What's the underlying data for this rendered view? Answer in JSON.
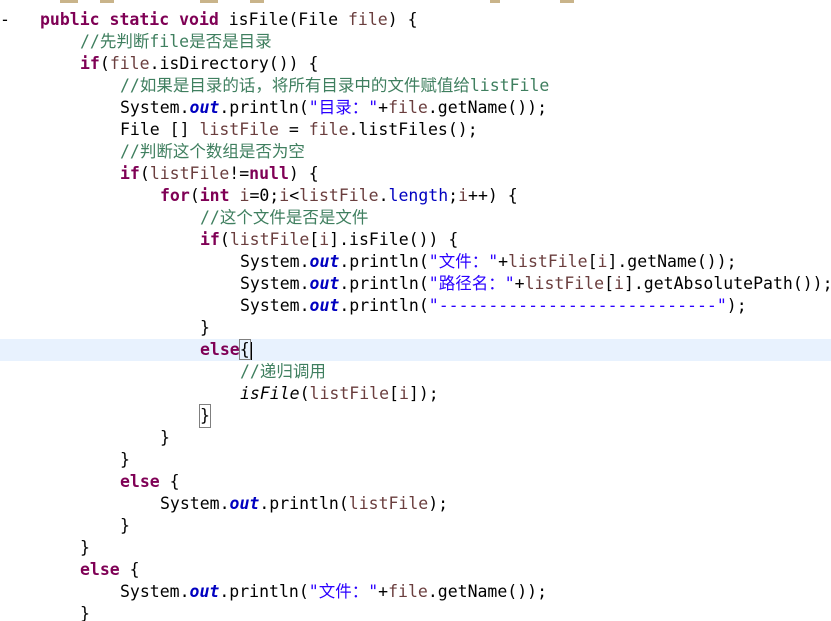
{
  "editor": {
    "language": "java",
    "colors": {
      "keyword": "#7f0055",
      "comment": "#3f7f5f",
      "string": "#2a00ff",
      "field": "#0000c0",
      "variable": "#6a3e3e",
      "current_line": "#e8f2fe"
    },
    "lines": {
      "l01": {
        "kw1": "public static void",
        "rest": " isFile(File ",
        "var": "file",
        "end": ") {"
      },
      "l02": {
        "comment": "//先判断file是否是目录"
      },
      "l03": {
        "kw": "if",
        "a": "(",
        "var": "file",
        "b": ".isDirectory()) {"
      },
      "l04": {
        "comment": "//如果是目录的话，将所有目录中的文件赋值给listFile"
      },
      "l05": {
        "a": "System.",
        "field": "out",
        "b": ".println(",
        "str": "\"目录：\"",
        "c": "+",
        "var": "file",
        "d": ".getName());"
      },
      "l06": {
        "a": "File [] ",
        "var1": "listFile",
        "b": " = ",
        "var2": "file",
        "c": ".listFiles();"
      },
      "l07": {
        "comment": "//判断这个数组是否为空"
      },
      "l08": {
        "kw": "if",
        "a": "(",
        "var": "listFile",
        "b": "!=",
        "kw2": "null",
        "c": ") {"
      },
      "l09": {
        "kw": "for",
        "a": "(",
        "kw2": "int",
        "b": " ",
        "v1": "i",
        "c": "=0;",
        "v2": "i",
        "d": "<",
        "v3": "listFile",
        "e": ".",
        "f1": "length",
        "f": ";",
        "v4": "i",
        "g": "++) {"
      },
      "l10": {
        "comment": "//这个文件是否是文件"
      },
      "l11": {
        "kw": "if",
        "a": "(",
        "var": "listFile",
        "b": "[",
        "v2": "i",
        "c": "].isFile()) {"
      },
      "l12": {
        "a": "System.",
        "field": "out",
        "b": ".println(",
        "str": "\"文件：\"",
        "c": "+",
        "var": "listFile",
        "d": "[",
        "v2": "i",
        "e": "].getName());"
      },
      "l13": {
        "a": "System.",
        "field": "out",
        "b": ".println(",
        "str": "\"路径名：\"",
        "c": "+",
        "var": "listFile",
        "d": "[",
        "v2": "i",
        "e": "].getAbsolutePath());"
      },
      "l14": {
        "a": "System.",
        "field": "out",
        "b": ".println(",
        "str": "\"----------------------------\"",
        "c": ");"
      },
      "l15": {
        "a": "}"
      },
      "l16": {
        "kw": "else",
        "a": "{"
      },
      "l17": {
        "comment": "//递归调用"
      },
      "l18": {
        "sm": "isFile",
        "a": "(",
        "var": "listFile",
        "b": "[",
        "v2": "i",
        "c": "]);"
      },
      "l19": {
        "a": "}"
      },
      "l20": {
        "a": "}"
      },
      "l21": {
        "a": "}"
      },
      "l22": {
        "kw": "else",
        "a": " {"
      },
      "l23": {
        "a": "System.",
        "field": "out",
        "b": ".println(",
        "var": "listFile",
        "c": ");"
      },
      "l24": {
        "a": "}"
      },
      "l25": {
        "a": "}"
      },
      "l26": {
        "kw": "else",
        "a": " {"
      },
      "l27": {
        "a": "System.",
        "field": "out",
        "b": ".println(",
        "str": "\"文件：\"",
        "c": "+",
        "var": "file",
        "d": ".getName());"
      },
      "l28": {
        "a": "}"
      }
    }
  }
}
